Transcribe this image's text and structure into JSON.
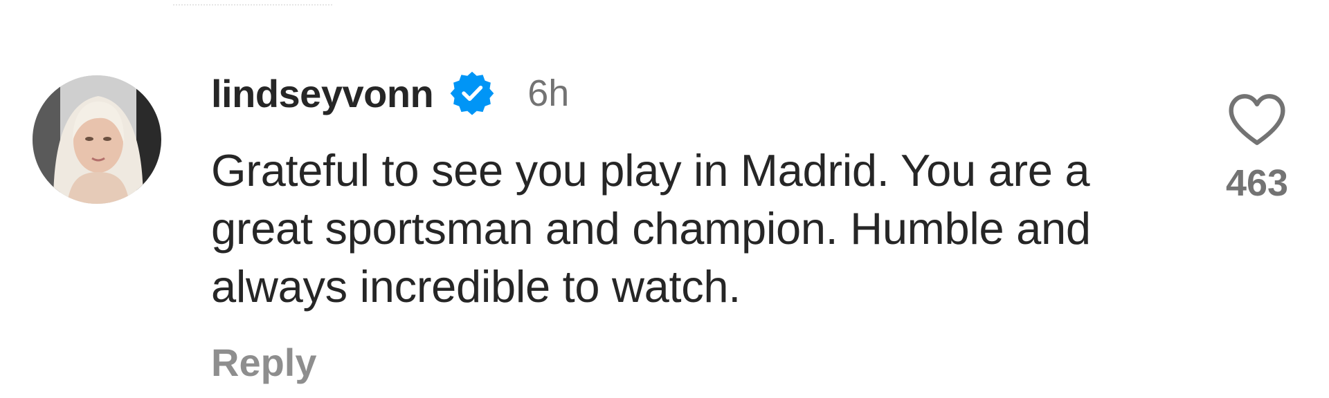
{
  "comment": {
    "username": "lindseyvonn",
    "verified": true,
    "timestamp": "6h",
    "text": "Grateful to see you play in Madrid. You are a great sportsman and champion. Humble and always incredible to watch.",
    "reply_label": "Reply",
    "like_count": "463"
  },
  "colors": {
    "text_primary": "#262626",
    "text_secondary": "#737373",
    "verified_blue": "#0095f6"
  },
  "icons": {
    "avatar": "profile-photo",
    "verified": "verified-badge-icon",
    "like": "heart-outline-icon"
  }
}
